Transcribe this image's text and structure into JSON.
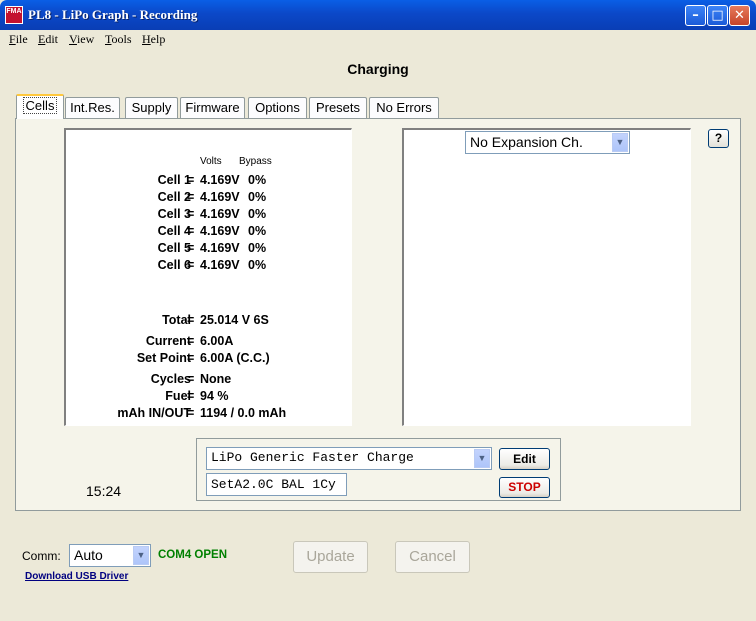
{
  "window": {
    "icon_text": "FMA",
    "title": "PL8 - LiPo Graph - Recording",
    "minimize_glyph": "–",
    "maximize_glyph": "□",
    "close_glyph": "✕"
  },
  "menu": [
    "File",
    "Edit",
    "View",
    "Tools",
    "Help"
  ],
  "status_heading": "Charging",
  "tabs": [
    "Cells",
    "Int.Res.",
    "Supply",
    "Firmware",
    "Options",
    "Presets",
    "No Errors"
  ],
  "cells_panel": {
    "col_volts": "Volts",
    "col_bypass": "Bypass",
    "cells": [
      {
        "label": "Cell 1",
        "volts": "4.169V",
        "bypass": "0%"
      },
      {
        "label": "Cell 2",
        "volts": "4.169V",
        "bypass": "0%"
      },
      {
        "label": "Cell 3",
        "volts": "4.169V",
        "bypass": "0%"
      },
      {
        "label": "Cell 4",
        "volts": "4.169V",
        "bypass": "0%"
      },
      {
        "label": "Cell 5",
        "volts": "4.169V",
        "bypass": "0%"
      },
      {
        "label": "Cell 6",
        "volts": "4.169V",
        "bypass": "0%"
      }
    ],
    "stats": [
      {
        "label": "Total",
        "value": "25.014 V  6S"
      },
      {
        "label": "Current",
        "value": "6.00A"
      },
      {
        "label": "Set Point",
        "value": "6.00A  (C.C.)"
      },
      {
        "label": "Cycles",
        "value": "None"
      },
      {
        "label": "Fuel",
        "value": "94 %"
      },
      {
        "label": "mAh IN/OUT",
        "value": "1194 / 0.0 mAh"
      }
    ],
    "equals": "="
  },
  "expansion": {
    "selected": "No Expansion Ch."
  },
  "help_label": "?",
  "profile": {
    "selected": "LiPo Generic Faster Charge",
    "edit_label": "Edit",
    "status_text": "SetA2.0C BAL 1Cy",
    "stop_label": "STOP"
  },
  "clock": "15:24",
  "comm": {
    "label": "Comm:",
    "selected": "Auto",
    "status": "COM4 OPEN",
    "driver_link": "Download USB Driver"
  },
  "buttons": {
    "update": "Update",
    "cancel": "Cancel"
  },
  "colors": {
    "stop": "#cc0000",
    "status_ok": "#008000",
    "link": "#000080"
  }
}
